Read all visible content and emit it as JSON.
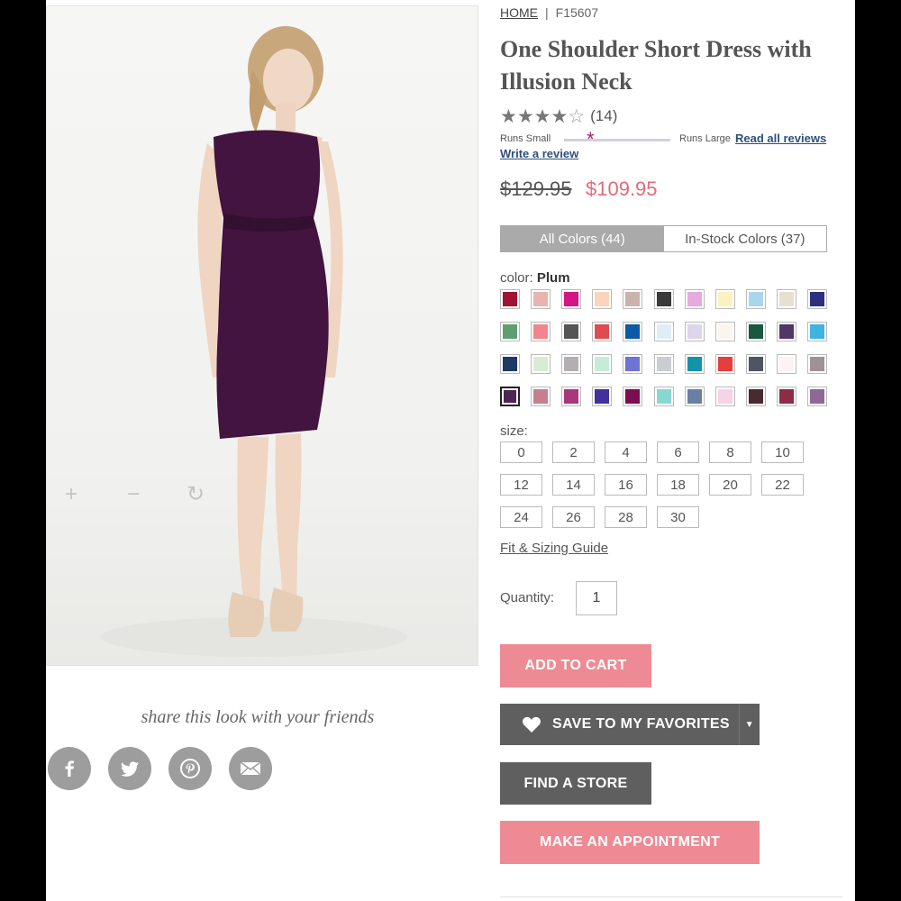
{
  "breadcrumb": {
    "home": "HOME",
    "separator": "|",
    "sku": "F15607"
  },
  "product": {
    "title": "One Shoulder Short Dress with Illusion Neck",
    "rating_stars": "★★★★",
    "rating_empty_star": "☆",
    "rating_value": 4,
    "review_count": "(14)",
    "fit": {
      "left_label": "Runs Small",
      "right_label": "Runs Large",
      "marker": "*",
      "position": 0.4
    },
    "read_reviews": "Read all reviews",
    "write_review": "Write a review",
    "old_price": "$129.95",
    "new_price": "$109.95"
  },
  "gallery": {
    "zoom_in": "+",
    "zoom_out": "−",
    "rotate": "↻"
  },
  "colors": {
    "tabs": [
      "All Colors (44)",
      "In-Stock Colors (37)"
    ],
    "active_tab": 0,
    "label_prefix": "color:",
    "selected_name": "Plum",
    "selected_index": 33,
    "swatches": [
      "#a01333",
      "#e8b4b0",
      "#d41585",
      "#fbd5bb",
      "#c9b3ac",
      "#3b3b3b",
      "#e6a9e0",
      "#fbf2c0",
      "#a9d6ee",
      "#e6e0d0",
      "#2e2e80",
      "#5f9e6e",
      "#f0858f",
      "#555555",
      "#dc4d4f",
      "#0d5aa8",
      "#e1ecf9",
      "#ddd5eb",
      "#faf6ee",
      "#1a5840",
      "#4f3767",
      "#3fb3e2",
      "#1b3a64",
      "#d8ecd2",
      "#b4aeb2",
      "#c4ecd8",
      "#6d74d4",
      "#c9ced3",
      "#1393a8",
      "#e63d3d",
      "#4f5562",
      "#fdf2f4",
      "#9e9297",
      "#4e2453",
      "#c4808e",
      "#a8377b",
      "#44309c",
      "#7d0c51",
      "#88d8d1",
      "#6b7fa4",
      "#f6d3e6",
      "#4a2a2e",
      "#8c2d48",
      "#8f6896"
    ]
  },
  "sizes": {
    "label": "size:",
    "options": [
      "0",
      "2",
      "4",
      "6",
      "8",
      "10",
      "12",
      "14",
      "16",
      "18",
      "20",
      "22",
      "24",
      "26",
      "28",
      "30"
    ]
  },
  "fit_guide": "Fit & Sizing Guide",
  "quantity": {
    "label": "Quantity:",
    "value": "1"
  },
  "buttons": {
    "add_to_cart": "ADD TO CART",
    "save_favorites": "SAVE TO MY FAVORITES",
    "find_store": "FIND A STORE",
    "appointment": "MAKE AN APPOINTMENT"
  },
  "share": {
    "title": "share this look with your friends"
  },
  "style_colors": {
    "accent_pink": "#ee8a93",
    "price_pink": "#e06b7a",
    "link_blue": "#2d4f7c",
    "dark_button": "#5f5f5f"
  }
}
